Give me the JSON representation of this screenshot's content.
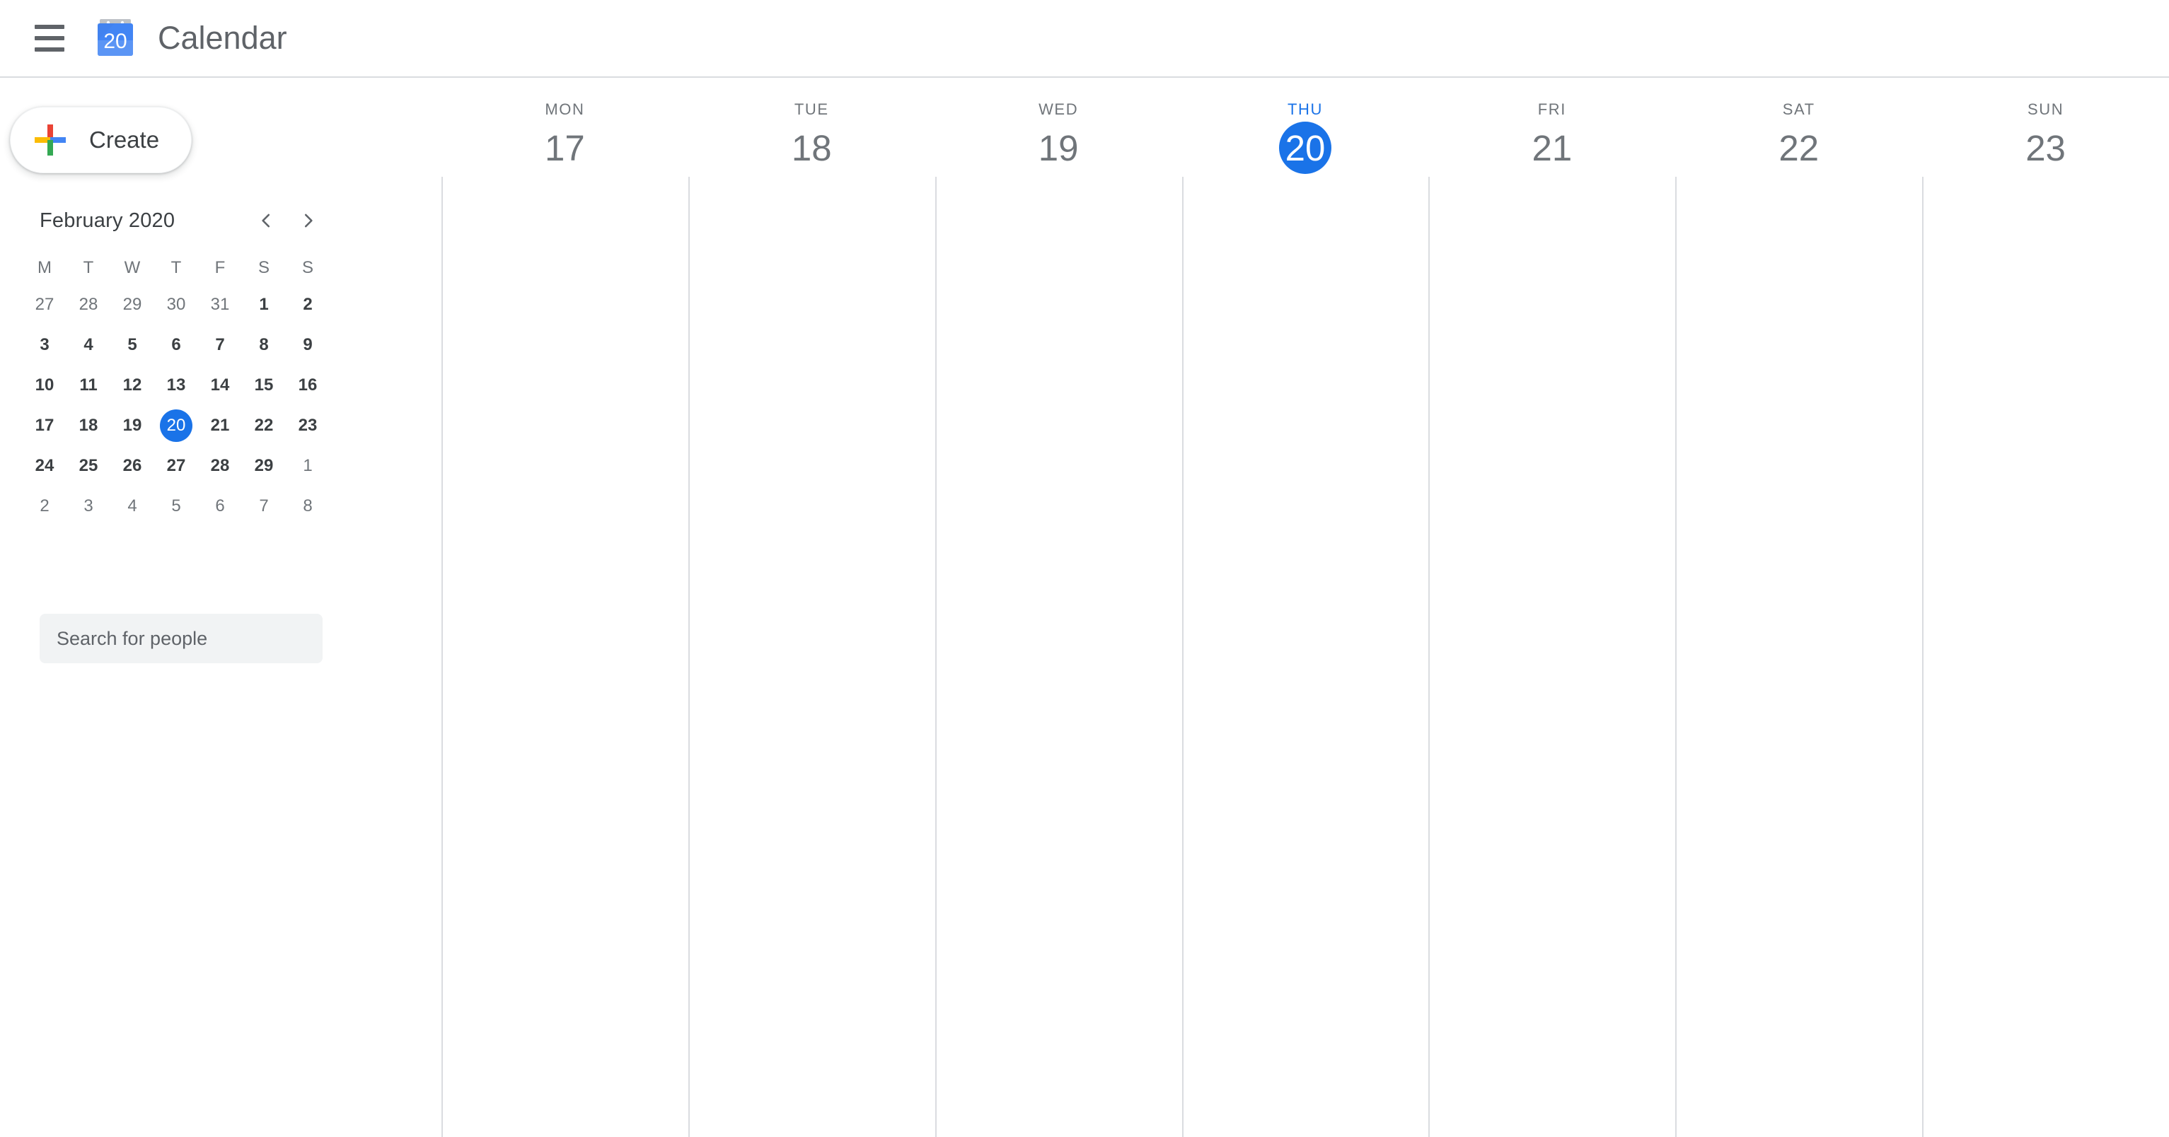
{
  "header": {
    "menu_icon": "hamburger-menu-icon",
    "logo_icon": "google-calendar-logo-icon",
    "logo_day_number": "20",
    "title": "Calendar"
  },
  "sidebar": {
    "create_button": {
      "label": "Create",
      "icon": "multicolor-plus-icon"
    },
    "mini_calendar": {
      "month_label": "February 2020",
      "prev_icon": "chevron-left-icon",
      "next_icon": "chevron-right-icon",
      "day_initials": [
        "M",
        "T",
        "W",
        "T",
        "F",
        "S",
        "S"
      ],
      "weeks": [
        [
          {
            "d": "27",
            "muted": true
          },
          {
            "d": "28",
            "muted": true
          },
          {
            "d": "29",
            "muted": true
          },
          {
            "d": "30",
            "muted": true
          },
          {
            "d": "31",
            "muted": true
          },
          {
            "d": "1",
            "muted": false
          },
          {
            "d": "2",
            "muted": false
          }
        ],
        [
          {
            "d": "3",
            "muted": false
          },
          {
            "d": "4",
            "muted": false
          },
          {
            "d": "5",
            "muted": false
          },
          {
            "d": "6",
            "muted": false
          },
          {
            "d": "7",
            "muted": false
          },
          {
            "d": "8",
            "muted": false
          },
          {
            "d": "9",
            "muted": false
          }
        ],
        [
          {
            "d": "10",
            "muted": false
          },
          {
            "d": "11",
            "muted": false
          },
          {
            "d": "12",
            "muted": false
          },
          {
            "d": "13",
            "muted": false
          },
          {
            "d": "14",
            "muted": false
          },
          {
            "d": "15",
            "muted": false
          },
          {
            "d": "16",
            "muted": false
          }
        ],
        [
          {
            "d": "17",
            "muted": false
          },
          {
            "d": "18",
            "muted": false
          },
          {
            "d": "19",
            "muted": false
          },
          {
            "d": "20",
            "muted": false,
            "today": true
          },
          {
            "d": "21",
            "muted": false
          },
          {
            "d": "22",
            "muted": false
          },
          {
            "d": "23",
            "muted": false
          }
        ],
        [
          {
            "d": "24",
            "muted": false
          },
          {
            "d": "25",
            "muted": false
          },
          {
            "d": "26",
            "muted": false
          },
          {
            "d": "27",
            "muted": false
          },
          {
            "d": "28",
            "muted": false
          },
          {
            "d": "29",
            "muted": false
          },
          {
            "d": "1",
            "muted": true
          }
        ],
        [
          {
            "d": "2",
            "muted": true
          },
          {
            "d": "3",
            "muted": true
          },
          {
            "d": "4",
            "muted": true
          },
          {
            "d": "5",
            "muted": true
          },
          {
            "d": "6",
            "muted": true
          },
          {
            "d": "7",
            "muted": true
          },
          {
            "d": "8",
            "muted": true
          }
        ]
      ]
    },
    "people_search": {
      "placeholder": "Search for people",
      "value": ""
    }
  },
  "week_view": {
    "days": [
      {
        "dow": "MON",
        "num": "17",
        "today": false
      },
      {
        "dow": "TUE",
        "num": "18",
        "today": false
      },
      {
        "dow": "WED",
        "num": "19",
        "today": false
      },
      {
        "dow": "THU",
        "num": "20",
        "today": true
      },
      {
        "dow": "FRI",
        "num": "21",
        "today": false
      },
      {
        "dow": "SAT",
        "num": "22",
        "today": false
      },
      {
        "dow": "SUN",
        "num": "23",
        "today": false
      }
    ]
  },
  "colors": {
    "accent_blue": "#1a73e8",
    "text_primary": "#3c4043",
    "text_secondary": "#70757a",
    "divider": "#dadce0",
    "input_background": "#f1f3f4",
    "plus_red": "#ea4335",
    "plus_yellow": "#fbbc04",
    "plus_blue": "#4285f4",
    "plus_green": "#34a853"
  }
}
